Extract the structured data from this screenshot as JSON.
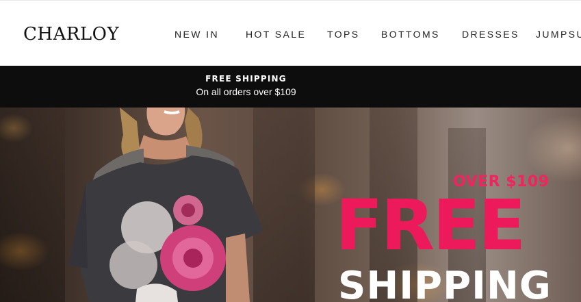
{
  "header": {
    "logo_text": "CHARLOY",
    "nav": [
      {
        "label": "NEW IN"
      },
      {
        "label": "HOT SALE"
      },
      {
        "label": "TOPS"
      },
      {
        "label": "BOTTOMS"
      },
      {
        "label": "DRESSES"
      },
      {
        "label": "JUMPSU"
      }
    ]
  },
  "announcement": {
    "title": "FREE SHIPPING",
    "subtitle": "On all orders over $109"
  },
  "hero": {
    "over_text": "OVER $109",
    "free_text": "FREE",
    "shipping_text": "SHIPPING"
  },
  "colors": {
    "announcement_bg": "#0d0d0d",
    "accent_pink": "#ec1a5a",
    "header_bg": "#ffffff"
  }
}
